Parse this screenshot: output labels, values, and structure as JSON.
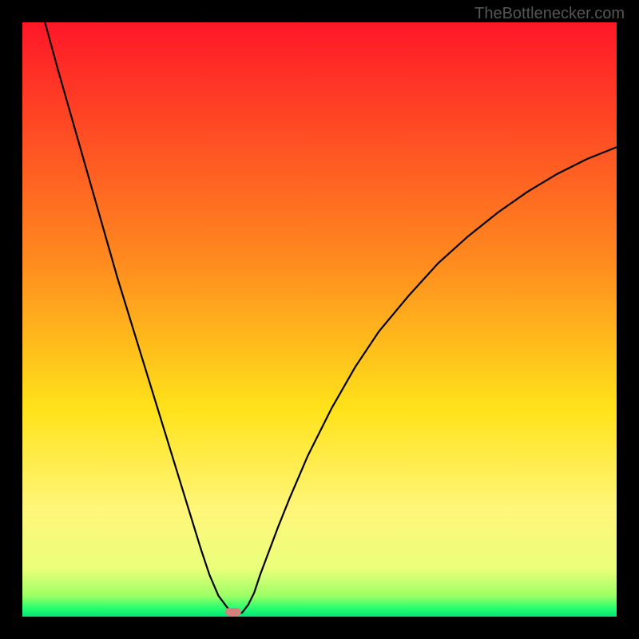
{
  "watermark": "TheBottlenecker.com",
  "chart_data": {
    "type": "line",
    "title": "",
    "xlabel": "",
    "ylabel": "",
    "xlim": [
      0,
      100
    ],
    "ylim": [
      0,
      100
    ],
    "curve": {
      "x": [
        3.8,
        6,
        8,
        10,
        12,
        14,
        16,
        18,
        20,
        22,
        24,
        26,
        28,
        30,
        31.5,
        33,
        34.5,
        35.5,
        36.2,
        37,
        38,
        39,
        40,
        41.5,
        43,
        45,
        48,
        52,
        56,
        60,
        65,
        70,
        75,
        80,
        85,
        90,
        95,
        100
      ],
      "y": [
        100,
        92,
        85,
        78,
        71,
        64,
        57,
        50.5,
        44,
        37.5,
        31,
        24.5,
        18,
        11.5,
        7,
        3.5,
        1.5,
        0.7,
        0.4,
        0.7,
        2,
        4,
        7,
        11,
        15,
        20,
        27,
        35,
        42,
        48,
        54,
        59.5,
        64,
        68,
        71.5,
        74.5,
        77,
        79
      ]
    },
    "marker": {
      "x": 35.5,
      "y": 0.8,
      "color": "#d88080"
    },
    "gradient_stops": [
      {
        "pos": 0,
        "color": "#ff1728"
      },
      {
        "pos": 40,
        "color": "#ff8a1f"
      },
      {
        "pos": 65,
        "color": "#ffe21a"
      },
      {
        "pos": 82,
        "color": "#fff67a"
      },
      {
        "pos": 92,
        "color": "#eaff7a"
      },
      {
        "pos": 96.5,
        "color": "#9cff66"
      },
      {
        "pos": 98.5,
        "color": "#2bff6e"
      },
      {
        "pos": 100,
        "color": "#00e676"
      }
    ],
    "background": "#000000",
    "curve_color": "#000000"
  }
}
